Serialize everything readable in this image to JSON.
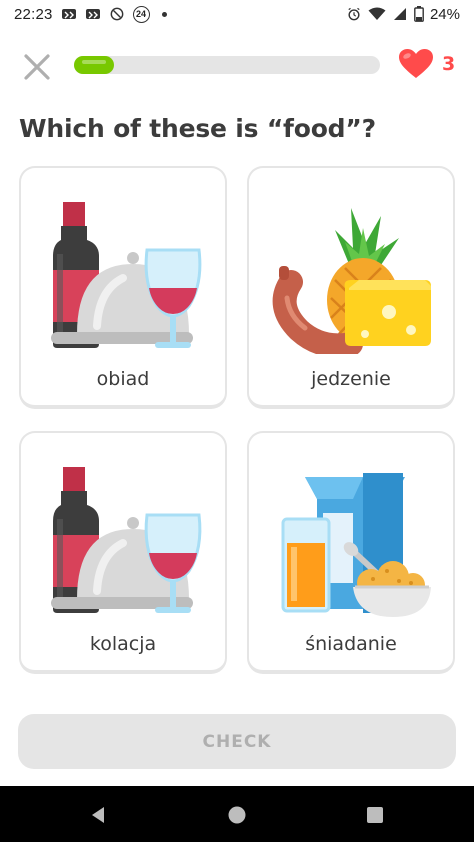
{
  "status_bar": {
    "time": "22:23",
    "badge_number": "24",
    "battery_percent": "24%",
    "icons": [
      "notification-icon",
      "notification-icon",
      "rotate-icon",
      "badge-icon",
      "dot-icon",
      "alarm-icon",
      "wifi-icon",
      "signal-icon",
      "battery-icon"
    ]
  },
  "lesson": {
    "progress": 0.13,
    "hearts": "3",
    "question": "Which of these is “food”?"
  },
  "choices": [
    {
      "label": "obiad",
      "icon": "wine-and-dish-icon"
    },
    {
      "label": "jedzenie",
      "icon": "food-pineapple-cheese-icon"
    },
    {
      "label": "kolacja",
      "icon": "wine-and-dish-icon"
    },
    {
      "label": "śniadanie",
      "icon": "breakfast-cereal-icon"
    }
  ],
  "check_button": {
    "label": "CHECK"
  },
  "colors": {
    "progress_green": "#78c800",
    "heart_red": "#ff4b4b",
    "card_border": "#e5e5e5",
    "button_disabled_bg": "#e5e5e5",
    "button_disabled_text": "#afafaf"
  }
}
